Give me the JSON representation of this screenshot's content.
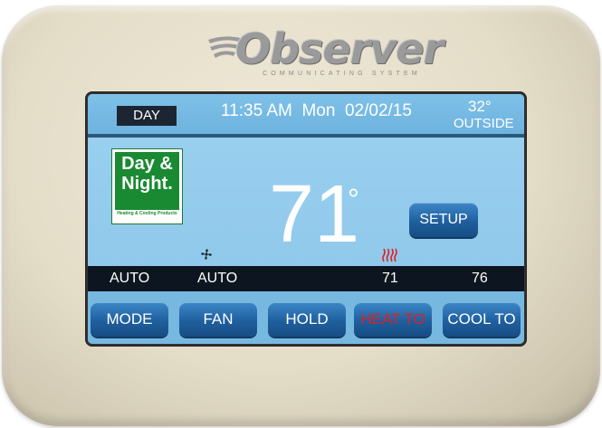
{
  "brand": {
    "name": "Observer",
    "tagline": "COMMUNICATING SYSTEM"
  },
  "header": {
    "mode_label": "DAY",
    "time": "11:35 AM",
    "weekday": "Mon",
    "date": "02/02/15",
    "outside_temp": "32°",
    "outside_label": "OUTSIDE"
  },
  "logo": {
    "line1": "Day &",
    "line2": "Night.",
    "sub": "Heating & Cooling Products"
  },
  "main": {
    "temperature": "71",
    "degree": "°"
  },
  "setup_button": "SETUP",
  "status": {
    "mode": "AUTO",
    "fan": "AUTO",
    "heat_setpoint": "71",
    "cool_setpoint": "76"
  },
  "buttons": {
    "mode": "MODE",
    "fan": "FAN",
    "hold": "HOLD",
    "heat_to": "HEAT TO",
    "cool_to": "COOL TO"
  },
  "icons": {
    "fan": "fan-icon",
    "heat": "heat-icon"
  },
  "colors": {
    "screen": "#8cc6ea",
    "button": "#1f5f9e",
    "heat_text": "#e02020",
    "status_bar": "#0d1620",
    "bezel": "#e4ddc8"
  }
}
